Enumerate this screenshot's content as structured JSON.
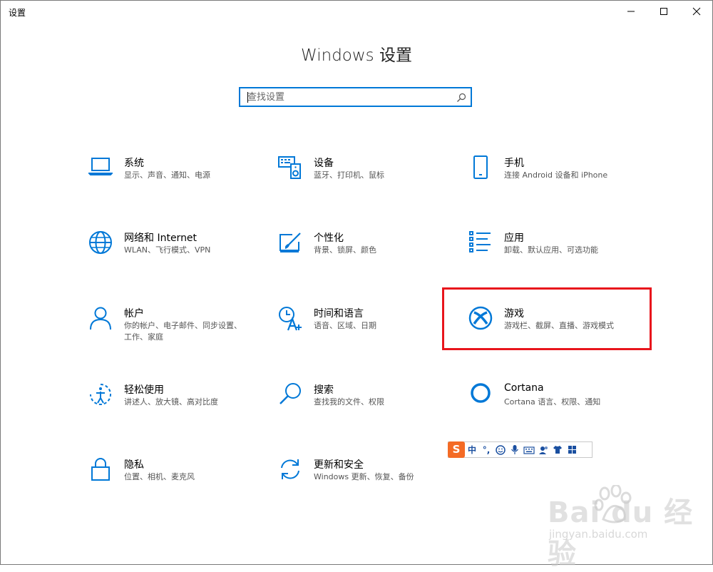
{
  "window": {
    "title": "设置"
  },
  "page": {
    "title": "Windows 设置"
  },
  "search": {
    "placeholder": "查找设置"
  },
  "tiles": [
    {
      "title": "系统",
      "subtitle": "显示、声音、通知、电源",
      "icon": "laptop-icon"
    },
    {
      "title": "设备",
      "subtitle": "蓝牙、打印机、鼠标",
      "icon": "keyboard-speaker-icon"
    },
    {
      "title": "手机",
      "subtitle": "连接 Android 设备和 iPhone",
      "icon": "phone-icon"
    },
    {
      "title": "网络和 Internet",
      "subtitle": "WLAN、飞行模式、VPN",
      "icon": "globe-icon"
    },
    {
      "title": "个性化",
      "subtitle": "背景、锁屏、颜色",
      "icon": "paint-icon"
    },
    {
      "title": "应用",
      "subtitle": "卸载、默认应用、可选功能",
      "icon": "apps-list-icon"
    },
    {
      "title": "帐户",
      "subtitle": "你的帐户、电子邮件、同步设置、工作、家庭",
      "icon": "person-icon"
    },
    {
      "title": "时间和语言",
      "subtitle": "语音、区域、日期",
      "icon": "time-language-icon"
    },
    {
      "title": "游戏",
      "subtitle": "游戏栏、截屏、直播、游戏模式",
      "icon": "xbox-icon"
    },
    {
      "title": "轻松使用",
      "subtitle": "讲述人、放大镜、高对比度",
      "icon": "ease-of-access-icon"
    },
    {
      "title": "搜索",
      "subtitle": "查找我的文件、权限",
      "icon": "search-magnifier-icon"
    },
    {
      "title": "Cortana",
      "subtitle": "Cortana 语言、权限、通知",
      "icon": "cortana-icon"
    },
    {
      "title": "隐私",
      "subtitle": "位置、相机、麦克风",
      "icon": "lock-icon"
    },
    {
      "title": "更新和安全",
      "subtitle": "Windows 更新、恢复、备份",
      "icon": "sync-icon"
    }
  ],
  "ime": {
    "logo": "S",
    "mode": "中",
    "punct": "°,"
  },
  "watermark": {
    "brand": "Bai du 经验",
    "url": "jingyan.baidu.com"
  },
  "colors": {
    "accent": "#0078d7",
    "highlight": "#e8151c"
  }
}
